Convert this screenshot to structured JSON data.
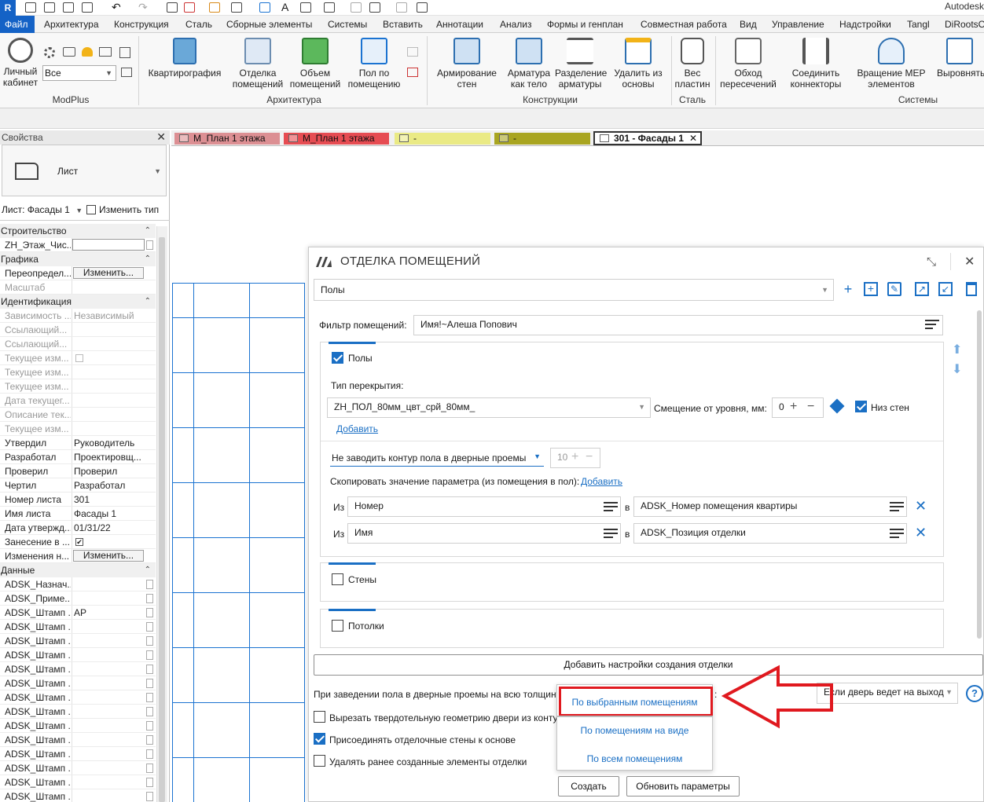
{
  "app": {
    "brand_letter": "R",
    "vendor": "Autodesk"
  },
  "ribbon_tabs": [
    "Файл",
    "Архитектура",
    "Конструкция",
    "Сталь",
    "Сборные элементы",
    "Системы",
    "Вставить",
    "Аннотации",
    "Анализ",
    "Формы и генплан",
    "Совместная работа",
    "Вид",
    "Управление",
    "Надстройки",
    "Tangl",
    "DiRootsO"
  ],
  "ribbon": {
    "modplus": {
      "lk_label": "Личный кабинет",
      "select_value": "Все",
      "group": "ModPlus"
    },
    "kvartiro": "Квартирография",
    "otdelka": "Отделка помещений",
    "obem": "Объем помещений",
    "pol": "Пол по помещению",
    "arch_group": "Архитектура",
    "armir": "Армирование стен",
    "armatura": "Арматура как тело",
    "razdel": "Разделение арматуры",
    "udalit": "Удалить из основы",
    "constr_group": "Конструкции",
    "ves": "Вес пластин",
    "steel_group": "Сталь",
    "obhod": "Обход пересечений",
    "soedin": "Соединить коннекторы",
    "vrash": "Вращение MEP элементов",
    "vyrov": "Выровнять",
    "sys_group": "Системы"
  },
  "properties": {
    "title": "Свойства",
    "type_name": "Лист",
    "selector": "Лист: Фасады 1",
    "edit_type": "Изменить тип",
    "rows": [
      {
        "kind": "sec",
        "k": "Строительство"
      },
      {
        "kind": "row",
        "k": "ZH_Этаж_Чис...",
        "v": "",
        "box": true
      },
      {
        "kind": "sec",
        "k": "Графика"
      },
      {
        "kind": "row",
        "k": "Переопредел...",
        "btn": "Изменить..."
      },
      {
        "kind": "dim",
        "k": "Масштаб",
        "v": ""
      },
      {
        "kind": "sec",
        "k": "Идентификация"
      },
      {
        "kind": "dim",
        "k": "Зависимость ...",
        "v": "Независимый"
      },
      {
        "kind": "dim",
        "k": "Ссылающий...",
        "v": ""
      },
      {
        "kind": "dim",
        "k": "Ссылающий...",
        "v": ""
      },
      {
        "kind": "dim",
        "k": "Текущее изм...",
        "v": "",
        "cb": true
      },
      {
        "kind": "dim",
        "k": "Текущее изм...",
        "v": ""
      },
      {
        "kind": "dim",
        "k": "Текущее изм...",
        "v": ""
      },
      {
        "kind": "dim",
        "k": "Дата текущег...",
        "v": ""
      },
      {
        "kind": "dim",
        "k": "Описание тек...",
        "v": ""
      },
      {
        "kind": "dim",
        "k": "Текущее изм...",
        "v": ""
      },
      {
        "kind": "row",
        "k": "Утвердил",
        "v": "Руководитель"
      },
      {
        "kind": "row",
        "k": "Разработал",
        "v": "Проектировщ..."
      },
      {
        "kind": "row",
        "k": "Проверил",
        "v": "Проверил"
      },
      {
        "kind": "row",
        "k": "Чертил",
        "v": "Разработал"
      },
      {
        "kind": "row",
        "k": "Номер листа",
        "v": "301"
      },
      {
        "kind": "row",
        "k": "Имя листа",
        "v": "Фасады 1"
      },
      {
        "kind": "row",
        "k": "Дата утвержд...",
        "v": "01/31/22"
      },
      {
        "kind": "row",
        "k": "Занесение в ...",
        "v": "",
        "cbon": true
      },
      {
        "kind": "row",
        "k": "Изменения н...",
        "btn": "Изменить..."
      },
      {
        "kind": "sec",
        "k": "Данные"
      },
      {
        "kind": "row",
        "k": "ADSK_Назнач...",
        "v": "",
        "cbr": true
      },
      {
        "kind": "row",
        "k": "ADSK_Приме...",
        "v": "",
        "cbr": true
      },
      {
        "kind": "row",
        "k": "ADSK_Штамп ...",
        "v": "АР",
        "cbr": true
      },
      {
        "kind": "row",
        "k": "ADSK_Штамп ...",
        "v": "",
        "cbr": true
      },
      {
        "kind": "row",
        "k": "ADSK_Штамп ...",
        "v": "",
        "cbr": true
      },
      {
        "kind": "row",
        "k": "ADSK_Штамп ...",
        "v": "",
        "cbr": true
      },
      {
        "kind": "row",
        "k": "ADSK_Штамп ...",
        "v": "",
        "cbr": true
      },
      {
        "kind": "row",
        "k": "ADSK_Штамп ...",
        "v": "",
        "cbr": true
      },
      {
        "kind": "row",
        "k": "ADSK_Штамп ...",
        "v": "",
        "cbr": true
      },
      {
        "kind": "row",
        "k": "ADSK_Штамп ...",
        "v": "",
        "cbr": true
      },
      {
        "kind": "row",
        "k": "ADSK_Штамп ...",
        "v": "",
        "cbr": true
      },
      {
        "kind": "row",
        "k": "ADSK_Штамп ...",
        "v": "",
        "cbr": true
      },
      {
        "kind": "row",
        "k": "ADSK_Штамп ...",
        "v": "",
        "cbr": true
      },
      {
        "kind": "row",
        "k": "ADSK_Штамп ...",
        "v": "",
        "cbr": true
      },
      {
        "kind": "row",
        "k": "ADSK_Штамп ...",
        "v": "",
        "cbr": true
      },
      {
        "kind": "row",
        "k": "ADSK_Штамп ...",
        "v": "",
        "cbr": true
      }
    ]
  },
  "view_tabs": [
    {
      "label": "М_План 1 этажа",
      "color": "#dc8f93",
      "active": false
    },
    {
      "label": "М_План 1 этажа",
      "color": "#e64c52",
      "active": false
    },
    {
      "label": "-",
      "color": "#eaea85",
      "active": false
    },
    {
      "label": "-",
      "color": "#a9a521",
      "active": false
    },
    {
      "label": "301 - Фасады 1",
      "color": "#ffffff",
      "active": true
    }
  ],
  "dialog": {
    "title": "ОТДЕЛКА ПОМЕЩЕНИЙ",
    "preset": "Полы",
    "filter_label": "Фильтр помещений:",
    "filter_value": "Имя!~Алеша Попович",
    "floors": {
      "check_label": "Полы",
      "type_label": "Тип перекрытия:",
      "type_value": "ZH_ПОЛ_80мм_цвт_срй_80мм_",
      "offset_label": "Смещение от уровня, мм:",
      "offset_value": "0",
      "bottom_walls": "Низ стен",
      "add_link": "Добавить",
      "contour_select": "Не заводить контур пола в дверные проемы",
      "contour_num": "10",
      "copy_param_label": "Скопировать значение параметра (из помещения в пол):",
      "copy_add": "Добавить",
      "map_from": "Из",
      "map_to": "в",
      "mappings": [
        {
          "from": "Номер",
          "to": "ADSK_Номер помещения квартиры"
        },
        {
          "from": "Имя",
          "to": "ADSK_Позиция отделки"
        }
      ]
    },
    "walls_label": "Стены",
    "ceil_label": "Потолки",
    "add_settings": "Добавить настройки создания отделки",
    "door_text": "При заведении пола в дверные проемы на всю толщину",
    "door_select": "Если дверь ведет на выход",
    "opt1": "Вырезать твердотельную геометрию двери из конту",
    "opt2": "Присоединять отделочные стены к основе",
    "opt3": "Удалять ранее созданные элементы отделки",
    "create": "Создать",
    "update": "Обновить параметры"
  },
  "popup": {
    "items": [
      "По выбранным помещениям",
      "По помещениям на виде",
      "По всем помещениям"
    ]
  },
  "colors": {
    "accent": "#1a6fc4",
    "highlight": "#e0191f",
    "revit_blue": "#1462c6"
  }
}
